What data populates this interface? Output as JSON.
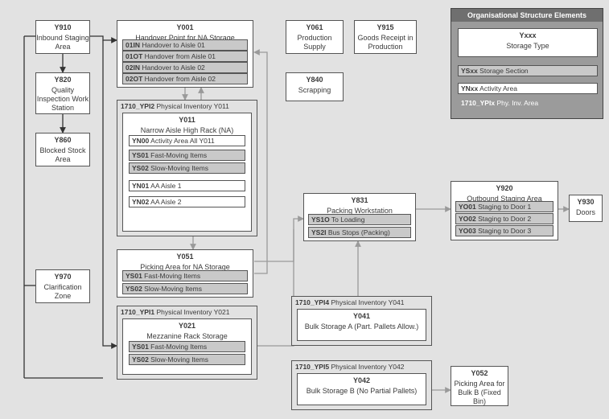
{
  "legend": {
    "header": "Organisational Structure Elements",
    "storageType": {
      "code": "Yxxx",
      "label": "Storage Type"
    },
    "storageSection": {
      "code": "YSxx",
      "label": "Storage Section"
    },
    "activityArea": {
      "code": "YNxx",
      "label": "Activity Area"
    },
    "phyInvArea": {
      "code": "1710_YPIx",
      "label": "Phy. Inv. Area"
    }
  },
  "nodes": {
    "y910": {
      "code": "Y910",
      "label": "Inbound Staging Area"
    },
    "y820": {
      "code": "Y820",
      "label": "Quality Inspection Work Station"
    },
    "y860": {
      "code": "Y860",
      "label": "Blocked Stock Area"
    },
    "y970": {
      "code": "Y970",
      "label": "Clarification Zone"
    },
    "y001": {
      "code": "Y001",
      "label": "Handover Point for NA Storage",
      "lines": [
        {
          "code": "01IN",
          "label": "Handover to Aisle 01"
        },
        {
          "code": "01OT",
          "label": "Handover from Aisle 01"
        },
        {
          "code": "02IN",
          "label": "Handover to Aisle 02"
        },
        {
          "code": "02OT",
          "label": "Handover from Aisle 02"
        }
      ]
    },
    "ypi2": {
      "areaCode": "1710_YPI2",
      "areaLabel": "Physical Inventory Y011",
      "inner": {
        "code": "Y011",
        "label": "Narrow Aisle High Rack (NA)"
      },
      "lines": [
        {
          "type": "w",
          "code": "YN00",
          "label": "Activity Area All Y011"
        },
        {
          "type": "g",
          "code": "YS01",
          "label": "Fast-Moving Items"
        },
        {
          "type": "g",
          "code": "YS02",
          "label": "Slow-Moving Items"
        },
        {
          "type": "w",
          "code": "YN01",
          "label": "AA Aisle 1"
        },
        {
          "type": "w",
          "code": "YN02",
          "label": "AA Aisle 2"
        }
      ]
    },
    "y051": {
      "code": "Y051",
      "label": "Picking Area for NA Storage",
      "lines": [
        {
          "code": "YS01",
          "label": "Fast-Moving Items"
        },
        {
          "code": "YS02",
          "label": "Slow-Moving Items"
        }
      ]
    },
    "ypi1": {
      "areaCode": "1710_YPI1",
      "areaLabel": "Physical Inventory Y021",
      "inner": {
        "code": "Y021",
        "label": "Mezzanine Rack Storage"
      },
      "lines": [
        {
          "code": "YS01",
          "label": "Fast-Moving Items"
        },
        {
          "code": "YS02",
          "label": "Slow-Moving Items"
        }
      ]
    },
    "y061": {
      "code": "Y061",
      "label": "Production Supply"
    },
    "y915": {
      "code": "Y915",
      "label": "Goods Receipt in Production"
    },
    "y840": {
      "code": "Y840",
      "label": "Scrapping"
    },
    "y831": {
      "code": "Y831",
      "label": "Packing Workstation",
      "lines": [
        {
          "code": "YS1O",
          "label": "To Loading"
        },
        {
          "code": "YS2I",
          "label": "Bus Stops (Packing)"
        }
      ]
    },
    "ypi4": {
      "areaCode": "1710_YPI4",
      "areaLabel": "Physical Inventory Y041",
      "inner": {
        "code": "Y041",
        "label": "Bulk Storage A (Part. Pallets Allow.)"
      }
    },
    "ypi5": {
      "areaCode": "1710_YPI5",
      "areaLabel": "Physical Inventory Y042",
      "inner": {
        "code": "Y042",
        "label": "Bulk Storage B (No Partial Pallets)"
      }
    },
    "y052": {
      "code": "Y052",
      "label": "Picking Area for Bulk B (Fixed Bin)"
    },
    "y920": {
      "code": "Y920",
      "label": "Outbound Staging Area",
      "lines": [
        {
          "code": "YO01",
          "label": "Staging to Door 1"
        },
        {
          "code": "YO02",
          "label": "Staging to Door 2"
        },
        {
          "code": "YO03",
          "label": "Staging to Door 3"
        }
      ]
    },
    "y930": {
      "code": "Y930",
      "label": "Doors"
    }
  },
  "chart_data": {
    "type": "diagram",
    "nodes": [
      {
        "id": "Y910",
        "label": "Inbound Staging Area"
      },
      {
        "id": "Y820",
        "label": "Quality Inspection Work Station"
      },
      {
        "id": "Y860",
        "label": "Blocked Stock Area"
      },
      {
        "id": "Y970",
        "label": "Clarification Zone"
      },
      {
        "id": "Y001",
        "label": "Handover Point for NA Storage"
      },
      {
        "id": "Y011",
        "label": "Narrow Aisle High Rack (NA)",
        "parent": "1710_YPI2"
      },
      {
        "id": "Y051",
        "label": "Picking Area for NA Storage"
      },
      {
        "id": "Y021",
        "label": "Mezzanine Rack Storage",
        "parent": "1710_YPI1"
      },
      {
        "id": "Y061",
        "label": "Production Supply"
      },
      {
        "id": "Y915",
        "label": "Goods Receipt in Production"
      },
      {
        "id": "Y840",
        "label": "Scrapping"
      },
      {
        "id": "Y831",
        "label": "Packing Workstation"
      },
      {
        "id": "Y041",
        "label": "Bulk Storage A (Part. Pallets Allow.)",
        "parent": "1710_YPI4"
      },
      {
        "id": "Y042",
        "label": "Bulk Storage B (No Partial Pallets)",
        "parent": "1710_YPI5"
      },
      {
        "id": "Y052",
        "label": "Picking Area for Bulk B (Fixed Bin)"
      },
      {
        "id": "Y920",
        "label": "Outbound Staging Area"
      },
      {
        "id": "Y930",
        "label": "Doors"
      }
    ],
    "edges": [
      {
        "from": "Y910",
        "to": "Y820"
      },
      {
        "from": "Y820",
        "to": "Y860"
      },
      {
        "from": "Y910",
        "to": "Y001"
      },
      {
        "from": "Y910",
        "to": "Y021"
      },
      {
        "from": "Y970",
        "to": "Y001"
      },
      {
        "from": "Y970",
        "to": "Y021"
      },
      {
        "from": "Y001",
        "to": "Y011",
        "bidir": true
      },
      {
        "from": "Y011",
        "to": "Y051"
      },
      {
        "from": "Y051",
        "to": "Y001"
      },
      {
        "from": "Y051",
        "to": "Y831"
      },
      {
        "from": "Y021",
        "to": "Y831"
      },
      {
        "from": "Y041",
        "to": "Y831"
      },
      {
        "from": "Y042",
        "to": "Y052"
      },
      {
        "from": "Y831",
        "to": "Y920"
      },
      {
        "from": "Y920",
        "to": "Y930"
      }
    ]
  }
}
